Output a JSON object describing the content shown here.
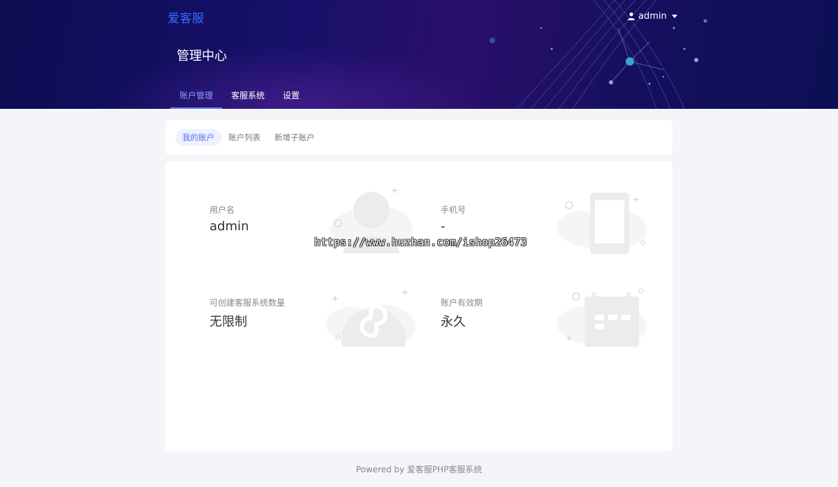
{
  "brand": "爱客服",
  "user": {
    "name": "admin"
  },
  "page_title": "管理中心",
  "main_nav": [
    {
      "label": "账户管理",
      "active": true
    },
    {
      "label": "客服系统",
      "active": false
    },
    {
      "label": "设置",
      "active": false
    }
  ],
  "sub_nav": [
    {
      "label": "我的账户",
      "active": true
    },
    {
      "label": "账户列表",
      "active": false
    },
    {
      "label": "新增子账户",
      "active": false
    }
  ],
  "account_info": {
    "username": {
      "label": "用户名",
      "value": "admin",
      "icon": "user-icon"
    },
    "phone": {
      "label": "手机号",
      "value": "-",
      "icon": "phone-icon"
    },
    "capacity": {
      "label": "可创建客服系统数量",
      "value": "无限制",
      "icon": "miniprogram-icon"
    },
    "validity": {
      "label": "账户有效期",
      "value": "永久",
      "icon": "calendar-icon"
    }
  },
  "watermark": "https://www.huzhan.com/ishop26473",
  "footer": "Powered by 爱客服PHP客服系统",
  "colors": {
    "accent": "#5b6cf4",
    "header_bg": "#13115e",
    "brand": "#3c6cff"
  }
}
